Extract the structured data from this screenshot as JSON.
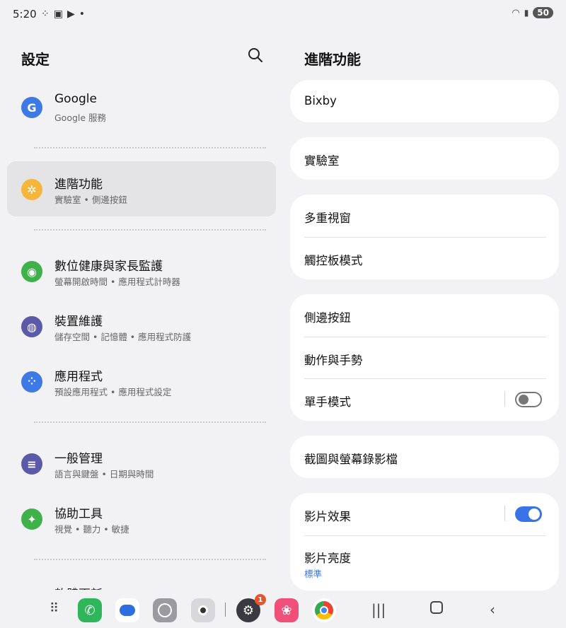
{
  "status": {
    "time": "5:20",
    "battery": "50"
  },
  "left": {
    "title": "設定",
    "items": [
      {
        "title": "Google",
        "subtitle": "Google 服務",
        "color": "#3d7ae5"
      },
      {
        "title": "進階功能",
        "subtitle": "實驗室 • 側邊按鈕",
        "color": "#f6b53b"
      },
      {
        "title": "數位健康與家長監護",
        "subtitle": "螢幕開啟時間 • 應用程式計時器",
        "color": "#3fb14a"
      },
      {
        "title": "裝置維護",
        "subtitle": "儲存空間 • 記憶體 • 應用程式防護",
        "color": "#5c5aa8"
      },
      {
        "title": "應用程式",
        "subtitle": "預設應用程式 • 應用程式設定",
        "color": "#3d7ae5"
      },
      {
        "title": "一般管理",
        "subtitle": "語言與鍵盤 • 日期與時間",
        "color": "#5c5aa8"
      },
      {
        "title": "協助工具",
        "subtitle": "視覺 • 聽力 • 敏捷",
        "color": "#3fb14a"
      },
      {
        "title": "軟體更新",
        "subtitle": "",
        "color": "#3d7ae5"
      }
    ]
  },
  "right": {
    "title": "進階功能",
    "items": {
      "bixby": "Bixby",
      "labs": "實驗室",
      "multi_window": "多重視窗",
      "touchpad": "觸控板模式",
      "side_button": "側邊按鈕",
      "motions": "動作與手勢",
      "one_hand": "單手模式",
      "screenshots": "截圖與螢幕錄影檔",
      "video_effects": "影片效果",
      "video_brightness": "影片亮度",
      "video_brightness_value": "標準"
    },
    "toggles": {
      "one_hand": false,
      "video_effects": true
    }
  },
  "dock": {
    "badge_settings": "1"
  }
}
